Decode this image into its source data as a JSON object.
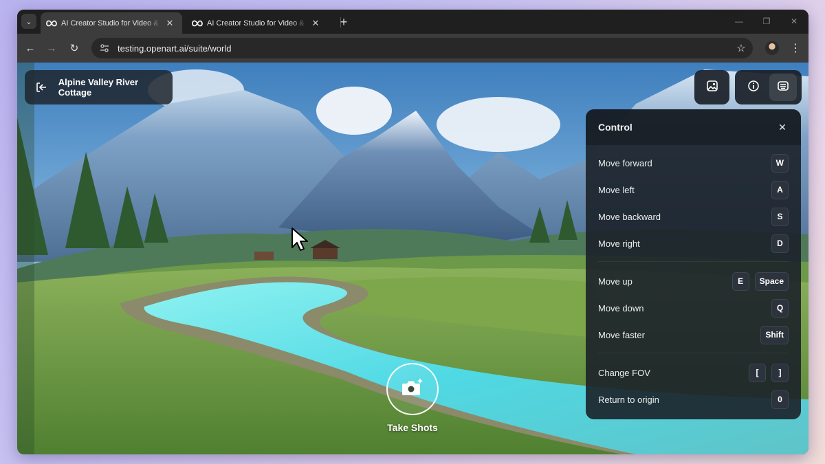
{
  "browser": {
    "tabs": [
      {
        "title": "AI Creator Studio for Video & Image",
        "active": true
      },
      {
        "title": "AI Creator Studio for Video & Image",
        "active": false
      }
    ],
    "url": "testing.openart.ai/suite/world"
  },
  "scene": {
    "title": "Alpine Valley River Cottage"
  },
  "control_panel": {
    "title": "Control",
    "rows": [
      {
        "action": "Move forward",
        "keys": [
          "W"
        ]
      },
      {
        "action": "Move left",
        "keys": [
          "A"
        ]
      },
      {
        "action": "Move backward",
        "keys": [
          "S"
        ]
      },
      {
        "action": "Move right",
        "keys": [
          "D"
        ]
      },
      {
        "action": "Move up",
        "keys": [
          "E",
          "Space"
        ]
      },
      {
        "action": "Move down",
        "keys": [
          "Q"
        ]
      },
      {
        "action": "Move faster",
        "keys": [
          "Shift"
        ]
      },
      {
        "action": "Change FOV",
        "keys": [
          "[",
          "]"
        ]
      },
      {
        "action": "Return to origin",
        "keys": [
          "0"
        ]
      }
    ]
  },
  "shutter": {
    "label": "Take Shots"
  },
  "icons": {
    "tab_favicon": "openart-infinity-icon",
    "exit": "exit-icon",
    "gallery": "image-gallery-icon",
    "info": "info-icon",
    "controls": "keyboard-controls-icon",
    "camera": "camera-sparkle-icon"
  },
  "colors": {
    "page_background": "#c9c3f2",
    "panel": "#1b2129",
    "river": "#4fd9e4"
  }
}
